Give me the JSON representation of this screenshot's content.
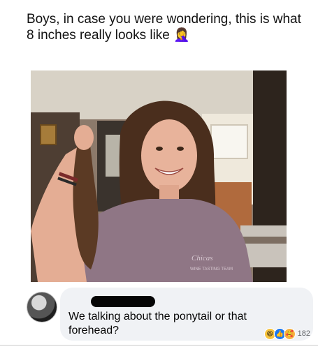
{
  "post": {
    "caption": "Boys, in case you were wondering, this is what 8 inches really looks like",
    "caption_emoji": "🤦‍♀️"
  },
  "photo": {
    "shirt_text": "Chicas",
    "shirt_subtext": "WINE TASTING TEAM",
    "icon": "photo-of-woman-holding-cut-ponytail"
  },
  "comment": {
    "text": "We talking about the ponytail or that forehead?",
    "author_redacted": true,
    "reaction_count": "182",
    "reactions": [
      "haha-icon",
      "like-icon",
      "care-icon"
    ]
  }
}
